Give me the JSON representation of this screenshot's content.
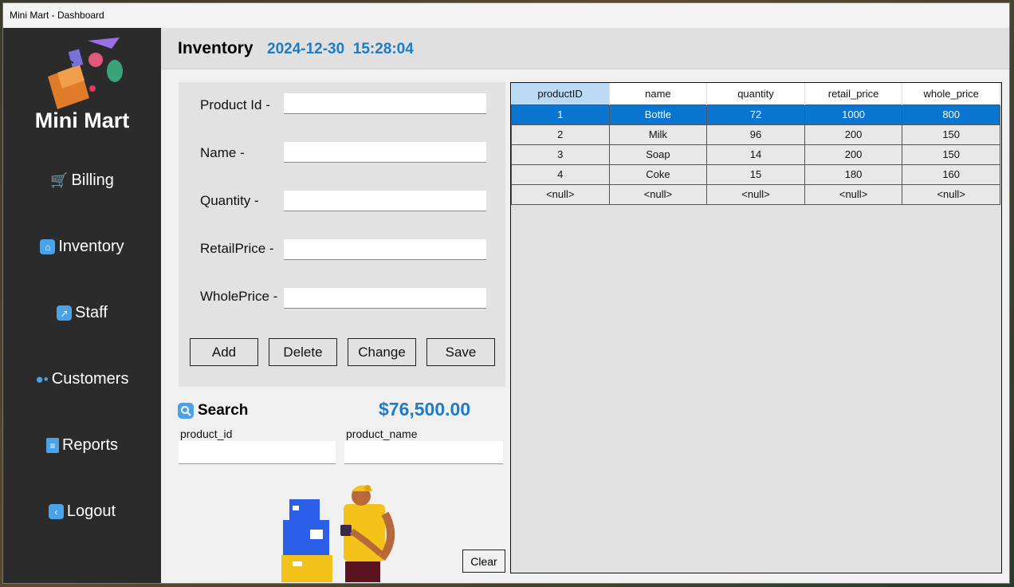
{
  "window": {
    "title": "Mini Mart - Dashboard"
  },
  "sidebar": {
    "brand": "Mini Mart",
    "items": [
      {
        "label": "Billing",
        "icon": "cart-icon"
      },
      {
        "label": "Inventory",
        "icon": "home-icon"
      },
      {
        "label": "Staff",
        "icon": "chart-icon"
      },
      {
        "label": "Customers",
        "icon": "users-icon"
      },
      {
        "label": "Reports",
        "icon": "report-icon"
      },
      {
        "label": "Logout",
        "icon": "back-icon"
      }
    ]
  },
  "header": {
    "title": "Inventory",
    "datetime": "2024-12-30  15:28:04"
  },
  "form": {
    "product_id_label": "Product Id -",
    "name_label": "Name -",
    "quantity_label": "Quantity -",
    "retail_label": "RetailPrice -",
    "whole_label": "WholePrice -",
    "buttons": {
      "add": "Add",
      "delete": "Delete",
      "change": "Change",
      "save": "Save"
    }
  },
  "search": {
    "title": "Search",
    "total": "$76,500.00",
    "product_id_label": "product_id",
    "product_name_label": "product_name",
    "clear": "Clear"
  },
  "table": {
    "columns": [
      "productID",
      "name",
      "quantity",
      "retail_price",
      "whole_price"
    ],
    "rows": [
      [
        "1",
        "Bottle",
        "72",
        "1000",
        "800"
      ],
      [
        "2",
        "Milk",
        "96",
        "200",
        "150"
      ],
      [
        "3",
        "Soap",
        "14",
        "200",
        "150"
      ],
      [
        "4",
        "Coke",
        "15",
        "180",
        "160"
      ],
      [
        "<null>",
        "<null>",
        "<null>",
        "<null>",
        "<null>"
      ]
    ],
    "selected_row": 0
  },
  "colors": {
    "accent": "#1f7cc4",
    "selected": "#0a74d1",
    "sidebar": "#2b2b2b"
  }
}
